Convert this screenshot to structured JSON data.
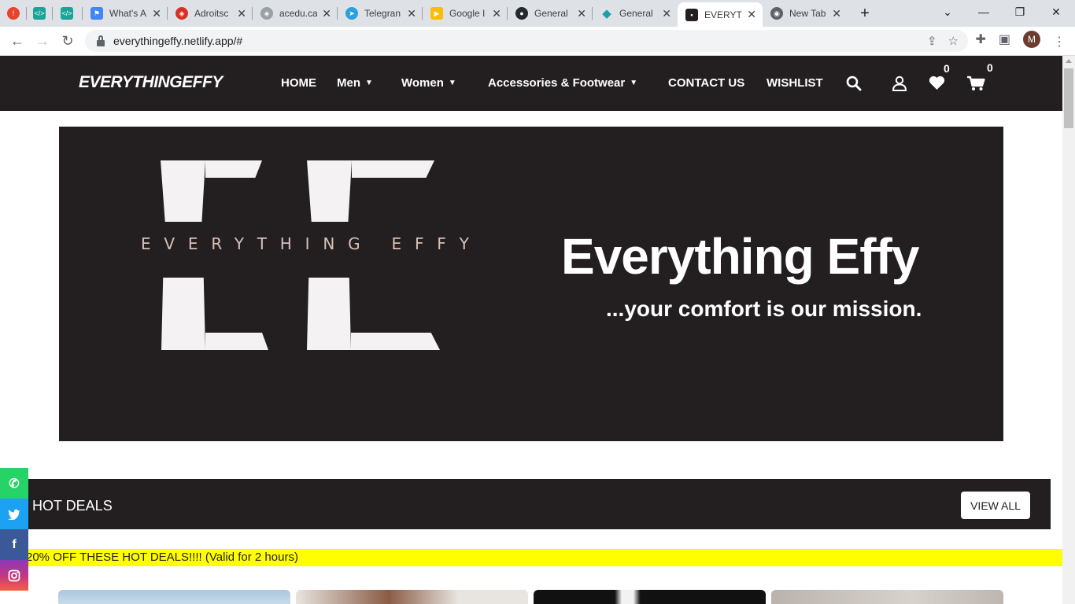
{
  "browser": {
    "tabs": [
      {
        "title": "",
        "favicon_color": "#e8442d"
      },
      {
        "title": "",
        "favicon_color": "#1aa398"
      },
      {
        "title": "",
        "favicon_color": "#1aa398"
      },
      {
        "title": "What's A",
        "favicon_color": "#4285f4"
      },
      {
        "title": "Adroitsc",
        "favicon_color": "#d93025"
      },
      {
        "title": "acedu.ca",
        "favicon_color": "#9aa0a6"
      },
      {
        "title": "Telegran",
        "favicon_color": "#2aa1da"
      },
      {
        "title": "Google I",
        "favicon_color": "#fbbc04"
      },
      {
        "title": "General",
        "favicon_color": "#24292f"
      },
      {
        "title": "General",
        "favicon_color": "#1a9eaa"
      },
      {
        "title": "EVERYTH",
        "favicon_color": "#231f20"
      },
      {
        "title": "New Tab",
        "favicon_color": "#5f6368"
      }
    ],
    "close_glyph": "✕",
    "new_tab_glyph": "+",
    "url": "everythingeffy.netlify.app/#",
    "profile_initial": "M"
  },
  "site": {
    "logo": "EVERYTHINGEFFY",
    "nav": {
      "home": "HOME",
      "men": "Men",
      "women": "Women",
      "accessories": "Accessories & Footwear",
      "contact": "CONTACT US",
      "wishlist": "WISHLIST"
    },
    "wishlist_count": "0",
    "cart_count": "0"
  },
  "hero": {
    "brand_text": "EVERYTHING EFFY",
    "title": "Everything Effy",
    "tagline": "...your comfort is our mission."
  },
  "hot_deals": {
    "title": "HOT DEALS",
    "view_all": "VIEW ALL",
    "promo": "20% OFF THESE HOT DEALS!!!! (Valid for 2 hours)"
  },
  "social": [
    {
      "name": "whatsapp",
      "color": "#25d366",
      "glyph": "✆"
    },
    {
      "name": "twitter",
      "color": "#1da1f2",
      "glyph": "🐦"
    },
    {
      "name": "facebook",
      "color": "#3b5998",
      "glyph": "f"
    },
    {
      "name": "instagram",
      "color": "#c13584",
      "glyph": "◎"
    }
  ]
}
